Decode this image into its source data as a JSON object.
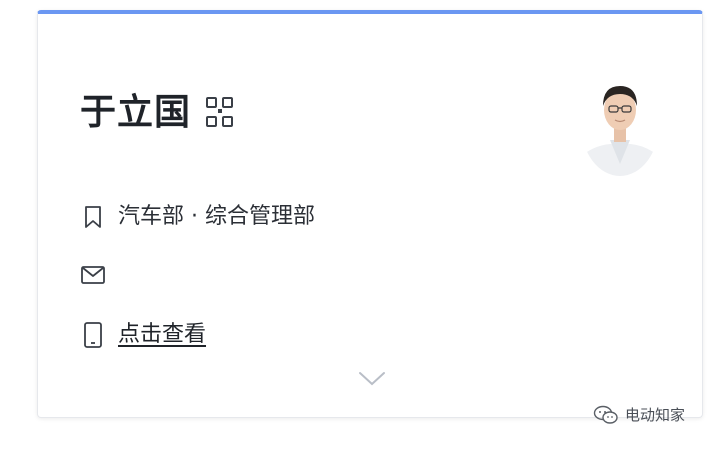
{
  "card": {
    "accent_color": "#6b97f2",
    "name": "于立国",
    "qr_icon": "qr-code-icon",
    "avatar_icon": "avatar-photo",
    "department": "汽车部 · 综合管理部",
    "department_icon": "bookmark-icon",
    "email_icon": "mail-icon",
    "phone_icon": "phone-icon",
    "phone_link": "点击查看",
    "expand_icon": "chevron-down-icon"
  },
  "watermark": {
    "icon": "wechat-icon",
    "text": "电动知家"
  }
}
